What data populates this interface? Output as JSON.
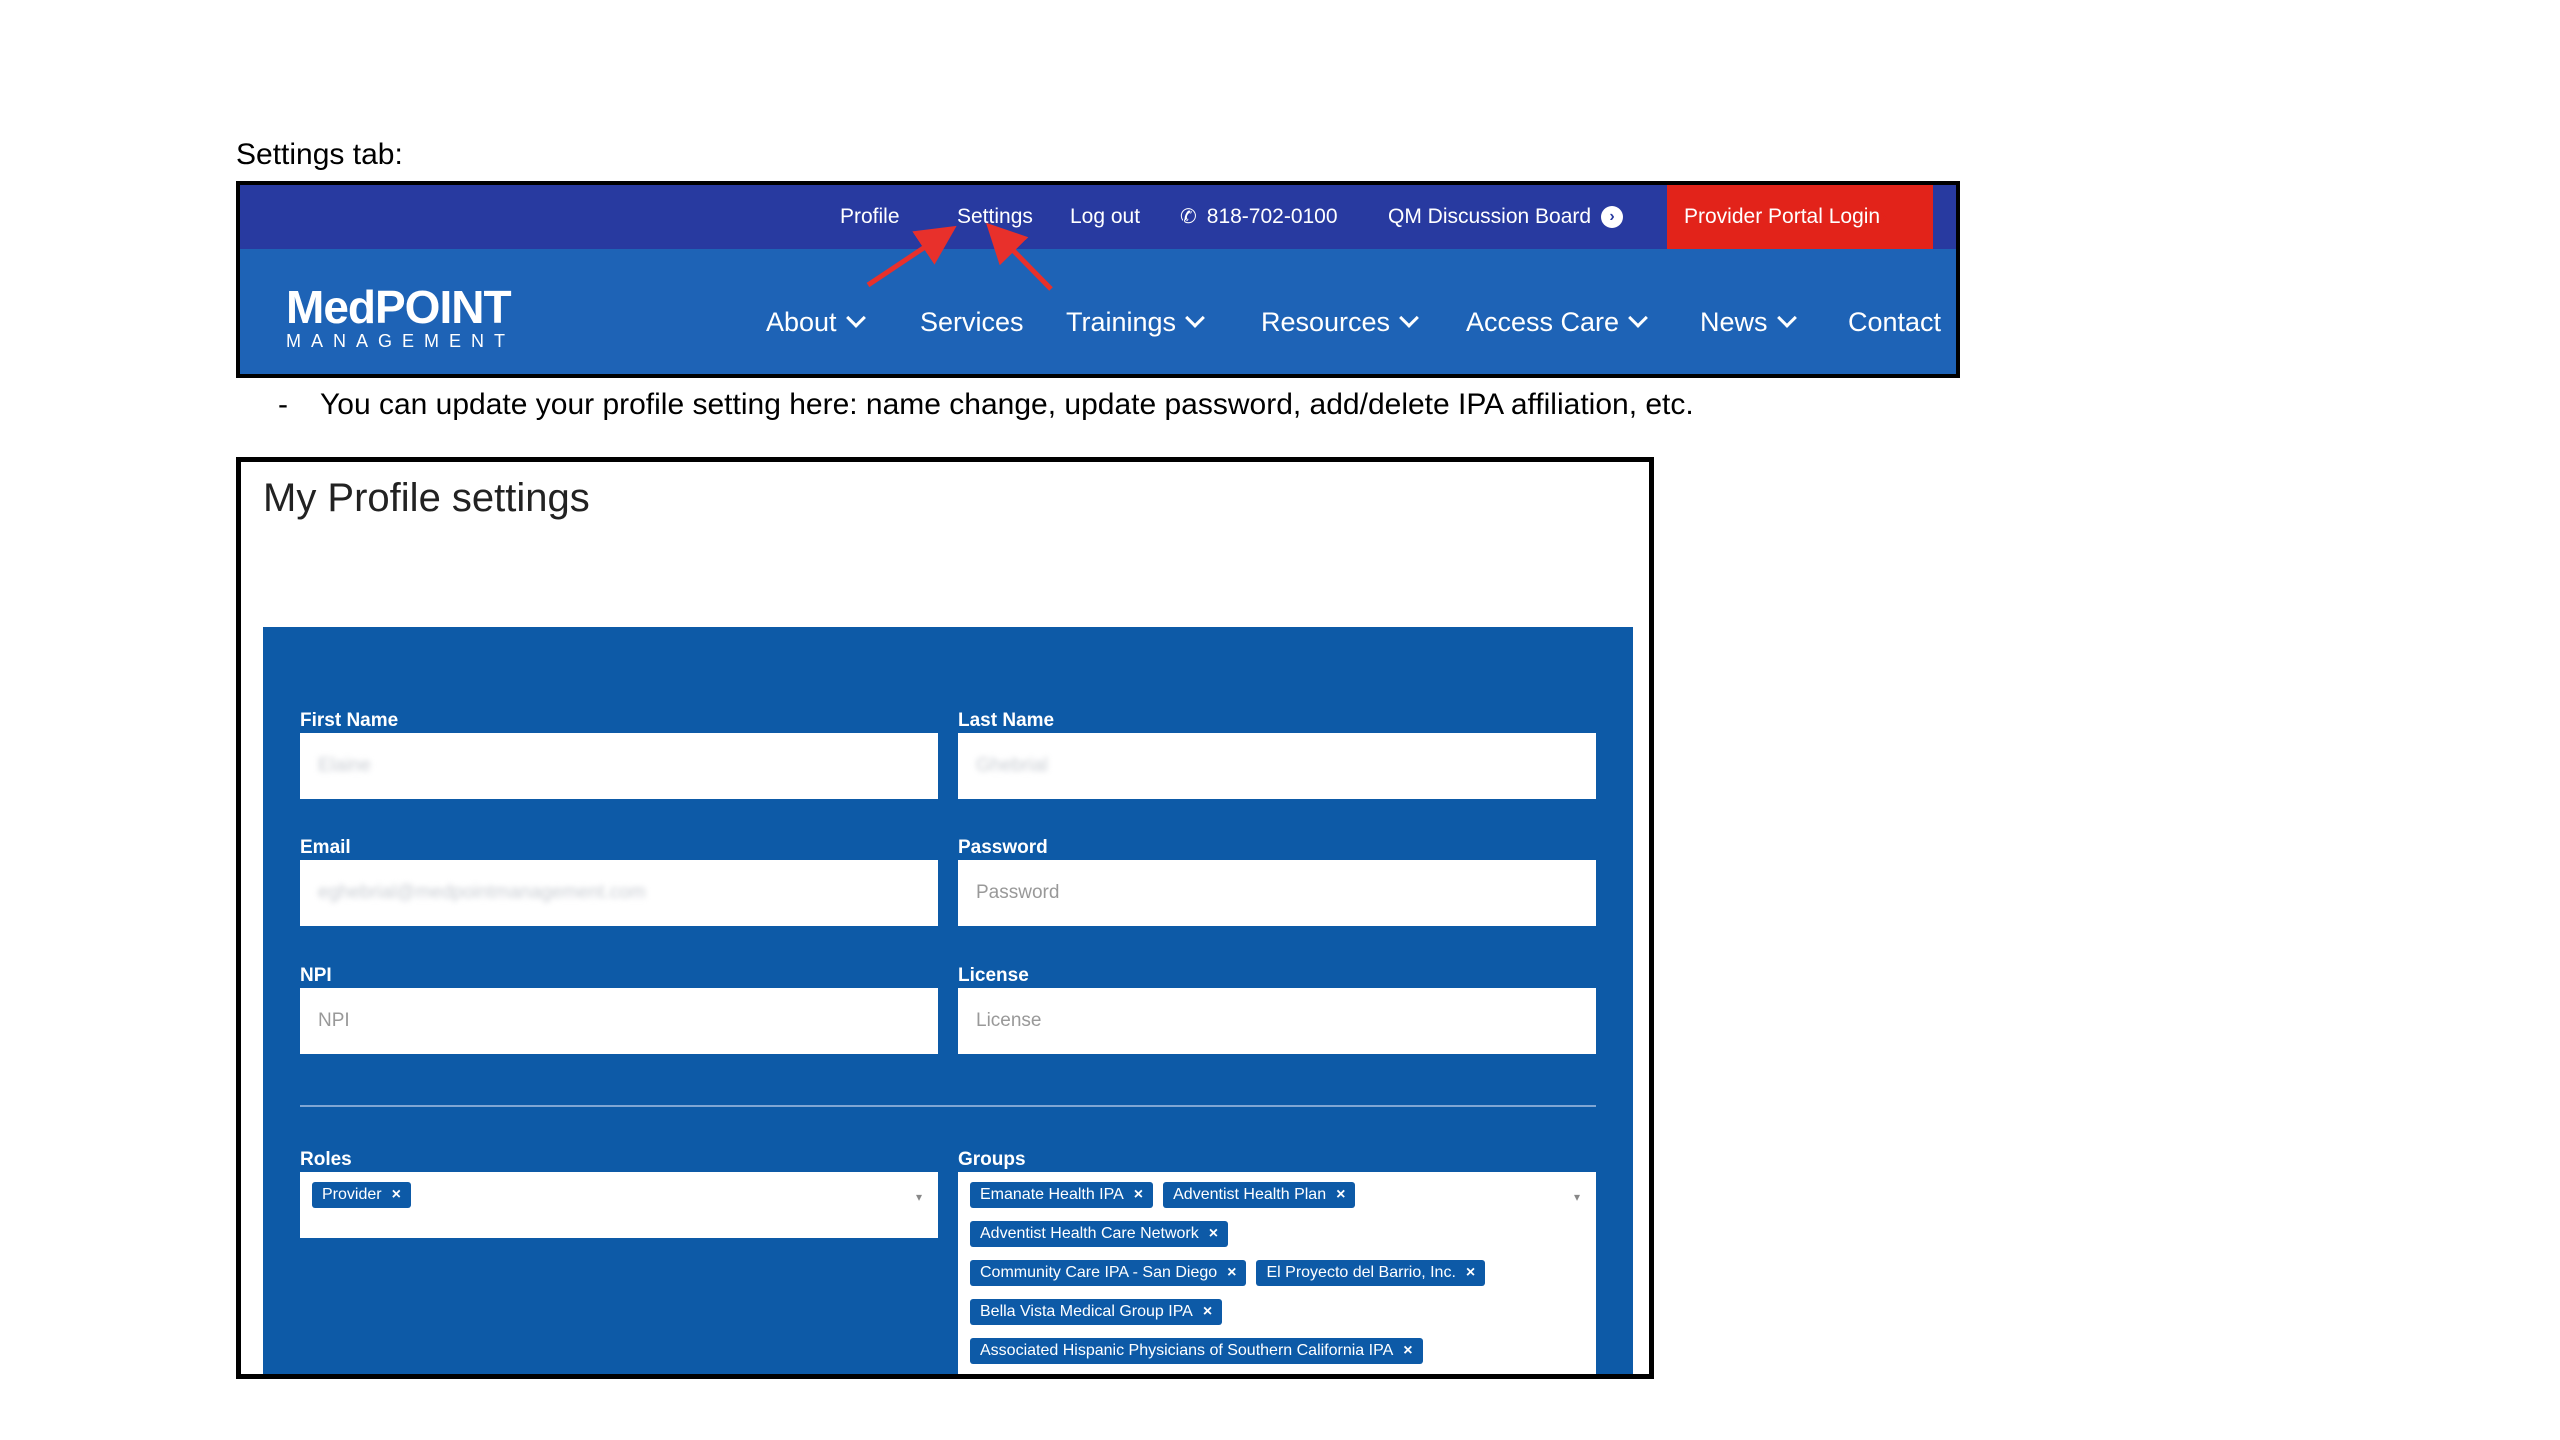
{
  "slide": {
    "heading": "Settings tab:",
    "note_dash": "-",
    "note": "You can update your profile setting here:  name change, update password, add/delete IPA affiliation, etc."
  },
  "header": {
    "utility": {
      "profile": "Profile",
      "settings": "Settings",
      "logout": "Log out",
      "phone": "818-702-0100",
      "qm_board": "QM Discussion Board",
      "portal_login": "Provider Portal Login"
    },
    "logo": {
      "main": "MedPOINT",
      "sub": "MANAGEMENT"
    },
    "nav": {
      "about": "About",
      "services": "Services",
      "trainings": "Trainings",
      "resources": "Resources",
      "access_care": "Access Care",
      "news": "News",
      "contact": "Contact"
    },
    "colors": {
      "utility_bar": "#283aa0",
      "nav_bar": "#1e63b6",
      "portal_button": "#e2231a",
      "annotation_arrow": "#e8302b"
    }
  },
  "profile": {
    "title": "My Profile settings",
    "fields": {
      "first_name": {
        "label": "First Name",
        "value": "Elaine"
      },
      "last_name": {
        "label": "Last Name",
        "value": "Ghebrial"
      },
      "email": {
        "label": "Email",
        "value": "eghebrial@medpointmanagement.com"
      },
      "password": {
        "label": "Password",
        "placeholder": "Password"
      },
      "npi": {
        "label": "NPI",
        "placeholder": "NPI"
      },
      "license": {
        "label": "License",
        "placeholder": "License"
      }
    },
    "roles": {
      "label": "Roles",
      "tags": [
        "Provider"
      ]
    },
    "groups": {
      "label": "Groups",
      "tags": [
        "Emanate Health IPA",
        "Adventist Health Plan",
        "Adventist Health Care Network",
        "Community Care IPA - San Diego",
        "El Proyecto del Barrio, Inc.",
        "Bella Vista Medical Group IPA",
        "Associated Hispanic Physicians of Southern California IPA"
      ]
    },
    "remove_glyph": "×",
    "caret_glyph": "▾",
    "colors": {
      "panel": "#0d5aa7"
    }
  }
}
